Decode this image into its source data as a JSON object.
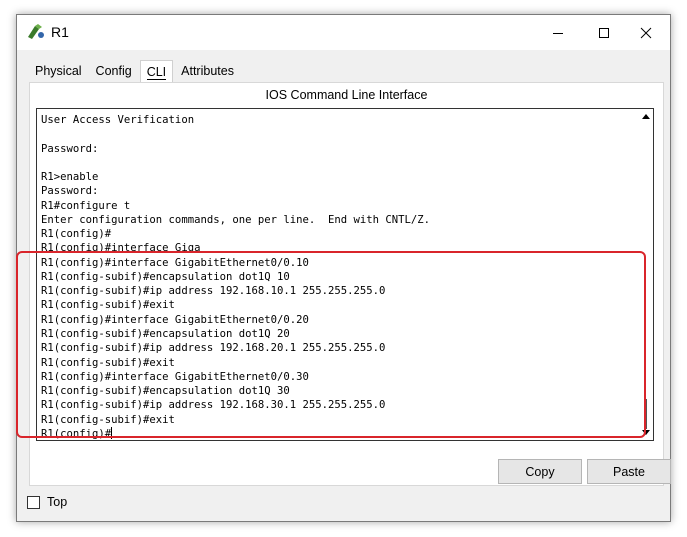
{
  "window": {
    "title": "R1"
  },
  "tabs": [
    {
      "label": "Physical",
      "active": false
    },
    {
      "label": "Config",
      "active": false
    },
    {
      "label": "CLI",
      "active": true
    },
    {
      "label": "Attributes",
      "active": false
    }
  ],
  "cli": {
    "header": "IOS Command Line Interface",
    "lines": [
      "User Access Verification",
      "",
      "Password:",
      "",
      "R1>enable",
      "Password:",
      "R1#configure t",
      "Enter configuration commands, one per line.  End with CNTL/Z.",
      "R1(config)#",
      "R1(config)#interface Giga",
      "R1(config)#interface GigabitEthernet0/0.10",
      "R1(config-subif)#encapsulation dot1Q 10",
      "R1(config-subif)#ip address 192.168.10.1 255.255.255.0",
      "R1(config-subif)#exit",
      "R1(config)#interface GigabitEthernet0/0.20",
      "R1(config-subif)#encapsulation dot1Q 20",
      "R1(config-subif)#ip address 192.168.20.1 255.255.255.0",
      "R1(config-subif)#exit",
      "R1(config)#interface GigabitEthernet0/0.30",
      "R1(config-subif)#encapsulation dot1Q 30",
      "R1(config-subif)#ip address 192.168.30.1 255.255.255.0",
      "R1(config-subif)#exit",
      "R1(config)#"
    ]
  },
  "buttons": {
    "copy_label": "Copy",
    "paste_label": "Paste"
  },
  "footer": {
    "top_label": "Top",
    "top_checked": false
  },
  "colors": {
    "highlight": "#d9252b",
    "window_bg": "#f0f0f0"
  }
}
